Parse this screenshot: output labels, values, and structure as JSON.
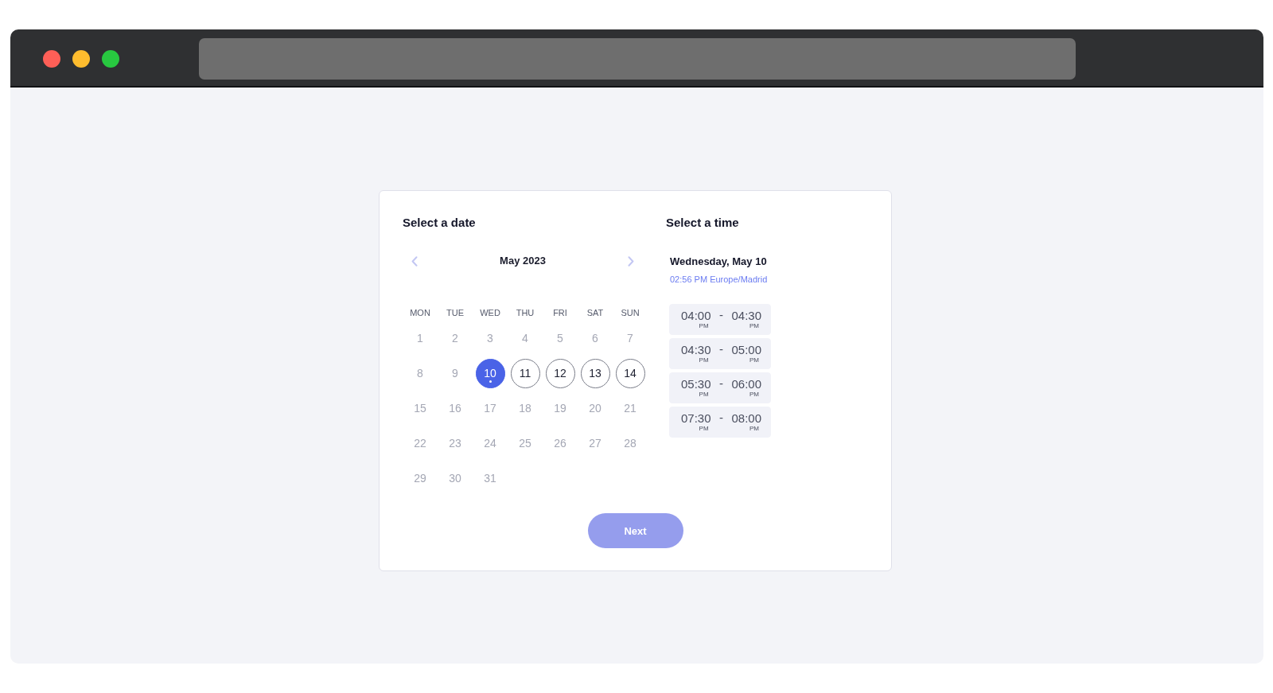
{
  "date_panel": {
    "title": "Select a date",
    "month": "May 2023",
    "weekdays": [
      "MON",
      "TUE",
      "WED",
      "THU",
      "FRI",
      "SAT",
      "SUN"
    ],
    "days": [
      {
        "label": "1",
        "available": false,
        "selected": false,
        "today": false
      },
      {
        "label": "2",
        "available": false,
        "selected": false,
        "today": false
      },
      {
        "label": "3",
        "available": false,
        "selected": false,
        "today": false
      },
      {
        "label": "4",
        "available": false,
        "selected": false,
        "today": false
      },
      {
        "label": "5",
        "available": false,
        "selected": false,
        "today": false
      },
      {
        "label": "6",
        "available": false,
        "selected": false,
        "today": false
      },
      {
        "label": "7",
        "available": false,
        "selected": false,
        "today": false
      },
      {
        "label": "8",
        "available": false,
        "selected": false,
        "today": false
      },
      {
        "label": "9",
        "available": false,
        "selected": false,
        "today": false
      },
      {
        "label": "10",
        "available": true,
        "selected": true,
        "today": true
      },
      {
        "label": "11",
        "available": true,
        "selected": false,
        "today": false
      },
      {
        "label": "12",
        "available": true,
        "selected": false,
        "today": false
      },
      {
        "label": "13",
        "available": true,
        "selected": false,
        "today": false
      },
      {
        "label": "14",
        "available": true,
        "selected": false,
        "today": false
      },
      {
        "label": "15",
        "available": false,
        "selected": false,
        "today": false
      },
      {
        "label": "16",
        "available": false,
        "selected": false,
        "today": false
      },
      {
        "label": "17",
        "available": false,
        "selected": false,
        "today": false
      },
      {
        "label": "18",
        "available": false,
        "selected": false,
        "today": false
      },
      {
        "label": "19",
        "available": false,
        "selected": false,
        "today": false
      },
      {
        "label": "20",
        "available": false,
        "selected": false,
        "today": false
      },
      {
        "label": "21",
        "available": false,
        "selected": false,
        "today": false
      },
      {
        "label": "22",
        "available": false,
        "selected": false,
        "today": false
      },
      {
        "label": "23",
        "available": false,
        "selected": false,
        "today": false
      },
      {
        "label": "24",
        "available": false,
        "selected": false,
        "today": false
      },
      {
        "label": "25",
        "available": false,
        "selected": false,
        "today": false
      },
      {
        "label": "26",
        "available": false,
        "selected": false,
        "today": false
      },
      {
        "label": "27",
        "available": false,
        "selected": false,
        "today": false
      },
      {
        "label": "28",
        "available": false,
        "selected": false,
        "today": false
      },
      {
        "label": "29",
        "available": false,
        "selected": false,
        "today": false
      },
      {
        "label": "30",
        "available": false,
        "selected": false,
        "today": false
      },
      {
        "label": "31",
        "available": false,
        "selected": false,
        "today": false
      }
    ]
  },
  "time_panel": {
    "title": "Select a time",
    "date": "Wednesday, May 10",
    "timezone": "02:56 PM Europe/Madrid",
    "slots": [
      {
        "start": "04:00",
        "start_period": "PM",
        "separator": "-",
        "end": "04:30",
        "end_period": "PM",
        "selected": false
      },
      {
        "start": "04:30",
        "start_period": "PM",
        "separator": "-",
        "end": "05:00",
        "end_period": "PM",
        "selected": false
      },
      {
        "start": "05:30",
        "start_period": "PM",
        "separator": "-",
        "end": "06:00",
        "end_period": "PM",
        "selected": false
      },
      {
        "start": "07:30",
        "start_period": "PM",
        "separator": "-",
        "end": "08:00",
        "end_period": "PM",
        "selected": false
      }
    ]
  },
  "next_button": {
    "label": "Next",
    "disabled": true
  }
}
